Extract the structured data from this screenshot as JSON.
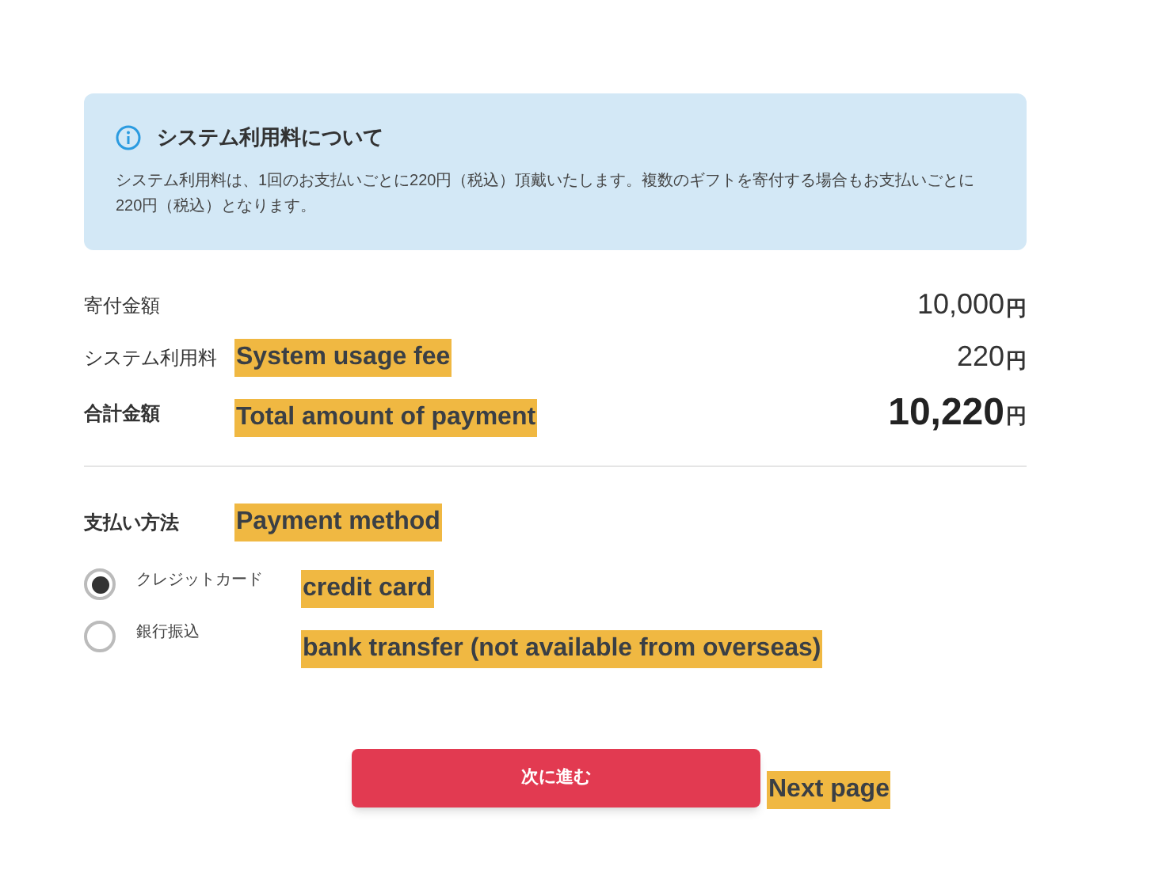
{
  "info": {
    "title": "システム利用料について",
    "body": "システム利用料は、1回のお支払いごとに220円（税込）頂戴いたします。複数のギフトを寄付する場合もお支払いごとに220円（税込）となります。"
  },
  "summary": [
    {
      "label": "寄付金額",
      "amount": "10,000",
      "unit": "円",
      "kind": "normal"
    },
    {
      "label": "システム利用料",
      "annotation": "System usage fee",
      "amount": "220",
      "unit": "円",
      "kind": "normal"
    },
    {
      "label": "合計金額",
      "annotation": "Total amount of payment",
      "amount": "10,220",
      "unit": "円",
      "kind": "total"
    }
  ],
  "payment": {
    "label": "支払い方法",
    "annotation": "Payment method",
    "options": [
      {
        "label": "クレジットカード",
        "annotation": "credit card",
        "selected": true
      },
      {
        "label": "銀行振込",
        "annotation": "bank transfer (not available from overseas)",
        "selected": false
      }
    ]
  },
  "next_button": {
    "label": "次に進む",
    "annotation": "Next page"
  }
}
